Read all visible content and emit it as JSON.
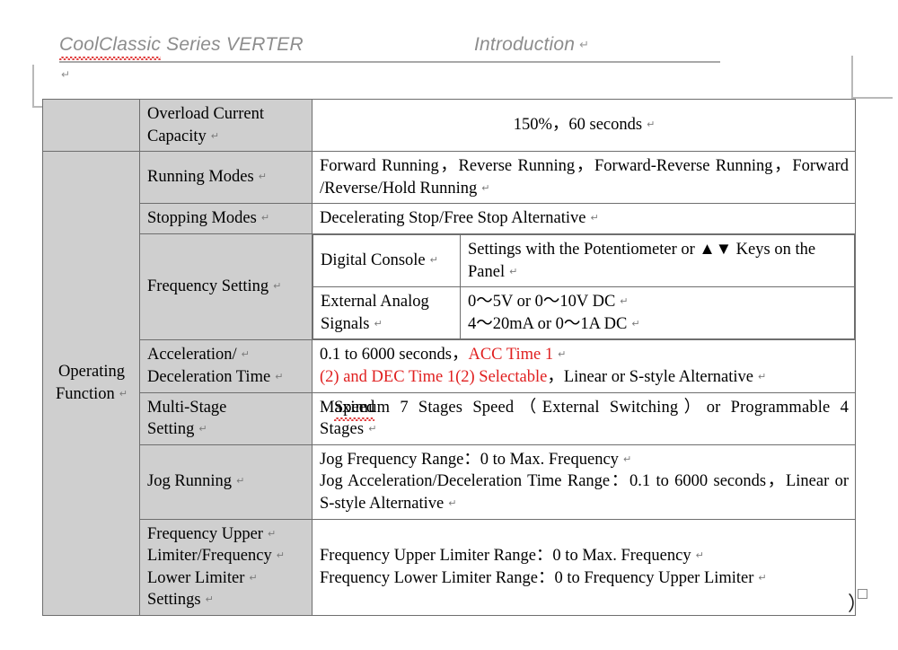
{
  "header": {
    "left_spellchecked": "CoolClassic",
    "left_rest": " Series VERTER",
    "right": "Introduction",
    "return_mark": "↵",
    "paragraph_mark": "↵"
  },
  "table": {
    "section_label": "Operating Function",
    "rows": [
      {
        "label": "Overload Current Capacity",
        "value": "150%，60 seconds",
        "align": "center"
      },
      {
        "label": "Running Modes",
        "value": "Forward Running，Reverse Running，Forward-Reverse Running，Forward /Reverse/Hold Running",
        "align": "justify"
      },
      {
        "label": "Stopping Modes",
        "value": "Decelerating Stop/Free Stop Alternative",
        "align": "left"
      },
      {
        "label": "Frequency Setting",
        "subrows": [
          {
            "sublabel": "Digital Console",
            "value": "Settings with the Potentiometer or ▲▼ Keys on the Panel"
          },
          {
            "sublabel": "External Analog Signals",
            "value_line1": "0～5V or 0～10V DC",
            "value_line2": "4～20mA or 0～1A DC"
          }
        ]
      },
      {
        "label_line1": "Acceleration/",
        "label_line2": "Deceleration Time",
        "value_black_1": "0.1 to 6000 seconds，",
        "value_red_1": "ACC Time 1",
        "value_red_2": "(2) and DEC Time 1(2) Selectable",
        "value_black_2": "，Linear or S-style Alternative"
      },
      {
        "label_part1": "Multi-Stage",
        "label_part2": "Speed",
        "label_part3": "Setting",
        "value": "Maximum 7 Stages Speed（External Switching）or Programmable 4 Stages",
        "align": "justify"
      },
      {
        "label": "Jog Running",
        "value_line1": "Jog Frequency Range：0 to Max. Frequency",
        "value_line2": "Jog Acceleration/Deceleration Time Range：0.1 to 6000 seconds，Linear or S-style Alternative"
      },
      {
        "label_line1": "Frequency Upper",
        "label_line2": "Limiter/Frequency",
        "label_line3": "Lower Limiter",
        "label_line4": "Settings",
        "value_line1": "Frequency Upper Limiter Range：0 to Max. Frequency",
        "value_line2": "Frequency Lower Limiter Range：0 to Frequency Upper Limiter"
      }
    ]
  },
  "artifacts": {
    "bottom_paren": "）"
  },
  "colors": {
    "shade": "#cfcfcf",
    "border": "#6e6e6e",
    "header_text": "#8d8d8d",
    "red_text": "#e02020",
    "spell_underline": "#e03a3a"
  }
}
